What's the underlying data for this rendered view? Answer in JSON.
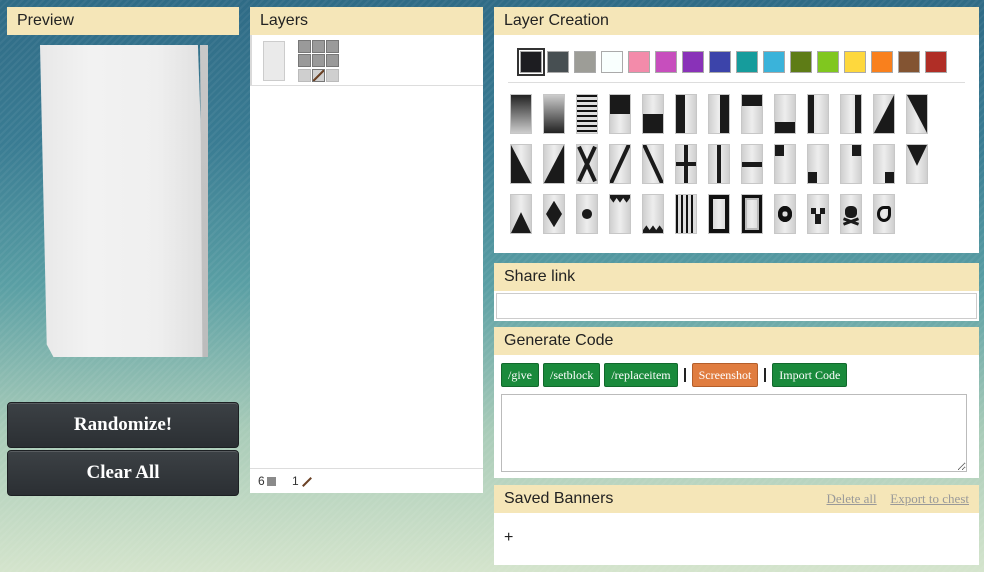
{
  "preview": {
    "title": "Preview"
  },
  "buttons": {
    "randomize": "Randomize!",
    "clear_all": "Clear All"
  },
  "layers": {
    "title": "Layers",
    "footer": {
      "blocks_count": "6",
      "sticks_count": "1"
    }
  },
  "creation": {
    "title": "Layer Creation",
    "colors": [
      "#1d1d21",
      "#474f52",
      "#9d9d97",
      "#f9fffe",
      "#f38baa",
      "#c74ebd",
      "#8932b8",
      "#3c44aa",
      "#169c9c",
      "#3ab3da",
      "#5e7c16",
      "#80c71f",
      "#fed83d",
      "#f9801d",
      "#835432",
      "#b02e26"
    ],
    "selected_color": "#1d1d21",
    "pattern_names": [
      "gradient-down-pattern",
      "gradient-up-pattern",
      "bricks-pattern",
      "top-half-pattern",
      "bottom-half-pattern",
      "left-half-pattern",
      "right-half-pattern",
      "top-stripe-pattern",
      "bottom-stripe-pattern",
      "left-stripe-pattern",
      "right-stripe-pattern",
      "diagonal-left-pattern",
      "diagonal-right-pattern",
      "diagonal-up-left-pattern",
      "diagonal-up-right-pattern",
      "cross-pattern",
      "diagonal-stripe-right-pattern",
      "diagonal-stripe-left-pattern",
      "straight-cross-pattern",
      "center-stripe-pattern",
      "middle-stripe-pattern",
      "top-left-square-pattern",
      "bottom-left-square-pattern",
      "top-right-square-pattern",
      "bottom-right-square-pattern",
      "top-triangle-pattern",
      "bottom-triangle-pattern",
      "rhombus-pattern",
      "circle-pattern",
      "top-triangles-pattern",
      "bottom-triangles-pattern",
      "small-stripes-pattern",
      "border-pattern",
      "curly-border-pattern",
      "flower-pattern",
      "creeper-pattern",
      "skull-pattern",
      "mojang-pattern"
    ]
  },
  "share": {
    "title": "Share link",
    "value": ""
  },
  "generate": {
    "title": "Generate Code",
    "give": "/give",
    "setblock": "/setblock",
    "replaceitem": "/replaceitem",
    "screenshot": "Screenshot",
    "import": "Import Code",
    "code": ""
  },
  "saved": {
    "title": "Saved Banners",
    "delete_all": "Delete all",
    "export": "Export to chest",
    "add": "+"
  }
}
